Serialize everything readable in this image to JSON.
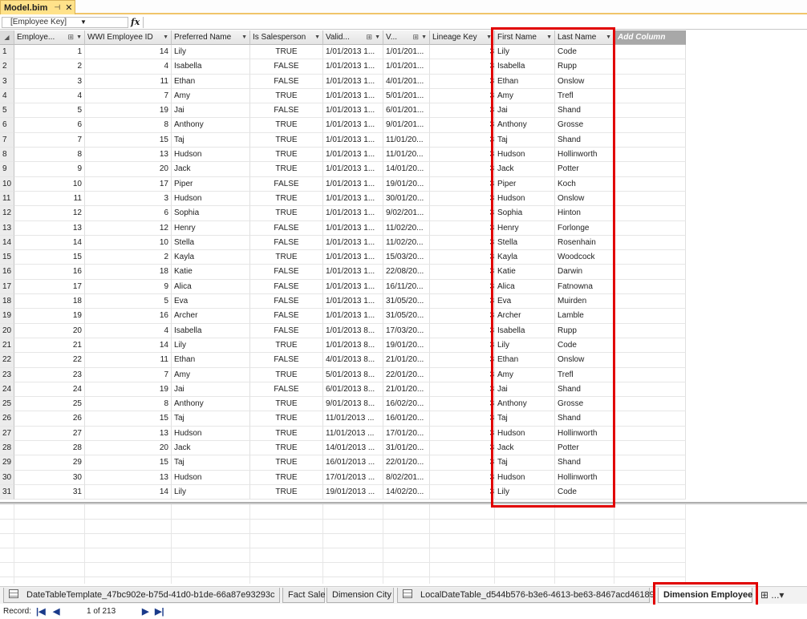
{
  "document_tab": {
    "title": "Model.bim",
    "pin_icon": "pin-icon",
    "close_icon": "close-icon"
  },
  "formula_bar": {
    "name_box": "[Employee Key]",
    "fx": "fx",
    "formula": ""
  },
  "grid": {
    "columns": [
      "Employe...",
      "WWI Employee ID",
      "Preferred Name",
      "Is Salesperson",
      "Valid...",
      "V...",
      "Lineage Key",
      "First Name",
      "Last Name"
    ],
    "add_column": "Add Column",
    "rows": [
      [
        "1",
        "1",
        "14",
        "Lily",
        "TRUE",
        "1/01/2013 1...",
        "1/01/201...",
        "3",
        "Lily",
        "Code"
      ],
      [
        "2",
        "2",
        "4",
        "Isabella",
        "FALSE",
        "1/01/2013 1...",
        "1/01/201...",
        "3",
        "Isabella",
        "Rupp"
      ],
      [
        "3",
        "3",
        "11",
        "Ethan",
        "FALSE",
        "1/01/2013 1...",
        "4/01/201...",
        "3",
        "Ethan",
        "Onslow"
      ],
      [
        "4",
        "4",
        "7",
        "Amy",
        "TRUE",
        "1/01/2013 1...",
        "5/01/201...",
        "3",
        "Amy",
        "Trefl"
      ],
      [
        "5",
        "5",
        "19",
        "Jai",
        "FALSE",
        "1/01/2013 1...",
        "6/01/201...",
        "3",
        "Jai",
        "Shand"
      ],
      [
        "6",
        "6",
        "8",
        "Anthony",
        "TRUE",
        "1/01/2013 1...",
        "9/01/201...",
        "3",
        "Anthony",
        "Grosse"
      ],
      [
        "7",
        "7",
        "15",
        "Taj",
        "TRUE",
        "1/01/2013 1...",
        "11/01/20...",
        "3",
        "Taj",
        "Shand"
      ],
      [
        "8",
        "8",
        "13",
        "Hudson",
        "TRUE",
        "1/01/2013 1...",
        "11/01/20...",
        "3",
        "Hudson",
        "Hollinworth"
      ],
      [
        "9",
        "9",
        "20",
        "Jack",
        "TRUE",
        "1/01/2013 1...",
        "14/01/20...",
        "3",
        "Jack",
        "Potter"
      ],
      [
        "10",
        "10",
        "17",
        "Piper",
        "FALSE",
        "1/01/2013 1...",
        "19/01/20...",
        "3",
        "Piper",
        "Koch"
      ],
      [
        "11",
        "11",
        "3",
        "Hudson",
        "TRUE",
        "1/01/2013 1...",
        "30/01/20...",
        "3",
        "Hudson",
        "Onslow"
      ],
      [
        "12",
        "12",
        "6",
        "Sophia",
        "TRUE",
        "1/01/2013 1...",
        "9/02/201...",
        "3",
        "Sophia",
        "Hinton"
      ],
      [
        "13",
        "13",
        "12",
        "Henry",
        "FALSE",
        "1/01/2013 1...",
        "11/02/20...",
        "3",
        "Henry",
        "Forlonge"
      ],
      [
        "14",
        "14",
        "10",
        "Stella",
        "FALSE",
        "1/01/2013 1...",
        "11/02/20...",
        "3",
        "Stella",
        "Rosenhain"
      ],
      [
        "15",
        "15",
        "2",
        "Kayla",
        "TRUE",
        "1/01/2013 1...",
        "15/03/20...",
        "3",
        "Kayla",
        "Woodcock"
      ],
      [
        "16",
        "16",
        "18",
        "Katie",
        "FALSE",
        "1/01/2013 1...",
        "22/08/20...",
        "3",
        "Katie",
        "Darwin"
      ],
      [
        "17",
        "17",
        "9",
        "Alica",
        "FALSE",
        "1/01/2013 1...",
        "16/11/20...",
        "3",
        "Alica",
        "Fatnowna"
      ],
      [
        "18",
        "18",
        "5",
        "Eva",
        "FALSE",
        "1/01/2013 1...",
        "31/05/20...",
        "3",
        "Eva",
        "Muirden"
      ],
      [
        "19",
        "19",
        "16",
        "Archer",
        "FALSE",
        "1/01/2013 1...",
        "31/05/20...",
        "3",
        "Archer",
        "Lamble"
      ],
      [
        "20",
        "20",
        "4",
        "Isabella",
        "FALSE",
        "1/01/2013 8...",
        "17/03/20...",
        "3",
        "Isabella",
        "Rupp"
      ],
      [
        "21",
        "21",
        "14",
        "Lily",
        "TRUE",
        "1/01/2013 8...",
        "19/01/20...",
        "3",
        "Lily",
        "Code"
      ],
      [
        "22",
        "22",
        "11",
        "Ethan",
        "FALSE",
        "4/01/2013 8...",
        "21/01/20...",
        "3",
        "Ethan",
        "Onslow"
      ],
      [
        "23",
        "23",
        "7",
        "Amy",
        "TRUE",
        "5/01/2013 8...",
        "22/01/20...",
        "3",
        "Amy",
        "Trefl"
      ],
      [
        "24",
        "24",
        "19",
        "Jai",
        "FALSE",
        "6/01/2013 8...",
        "21/01/20...",
        "3",
        "Jai",
        "Shand"
      ],
      [
        "25",
        "25",
        "8",
        "Anthony",
        "TRUE",
        "9/01/2013 8...",
        "16/02/20...",
        "3",
        "Anthony",
        "Grosse"
      ],
      [
        "26",
        "26",
        "15",
        "Taj",
        "TRUE",
        "11/01/2013 ...",
        "16/01/20...",
        "3",
        "Taj",
        "Shand"
      ],
      [
        "27",
        "27",
        "13",
        "Hudson",
        "TRUE",
        "11/01/2013 ...",
        "17/01/20...",
        "3",
        "Hudson",
        "Hollinworth"
      ],
      [
        "28",
        "28",
        "20",
        "Jack",
        "TRUE",
        "14/01/2013 ...",
        "31/01/20...",
        "3",
        "Jack",
        "Potter"
      ],
      [
        "29",
        "29",
        "15",
        "Taj",
        "TRUE",
        "16/01/2013 ...",
        "22/01/20...",
        "3",
        "Taj",
        "Shand"
      ],
      [
        "30",
        "30",
        "13",
        "Hudson",
        "TRUE",
        "17/01/2013 ...",
        "8/02/201...",
        "3",
        "Hudson",
        "Hollinworth"
      ],
      [
        "31",
        "31",
        "14",
        "Lily",
        "TRUE",
        "19/01/2013 ...",
        "14/02/20...",
        "3",
        "Lily",
        "Code"
      ]
    ]
  },
  "sheet_tabs": [
    {
      "label": "DateTableTemplate_47bc902e-b75d-41d0-b1de-66a87e93293c",
      "active": false
    },
    {
      "label": "Fact Sale",
      "active": false
    },
    {
      "label": "Dimension City",
      "active": false
    },
    {
      "label": "LocalDateTable_d544b576-b3e6-4613-be63-8467acd46189",
      "active": false
    },
    {
      "label": "Dimension Employee",
      "active": true
    }
  ],
  "tab_overflow": "...",
  "record_nav": {
    "label": "Record:",
    "position": "1 of 213"
  },
  "highlight_color": "#e10000"
}
